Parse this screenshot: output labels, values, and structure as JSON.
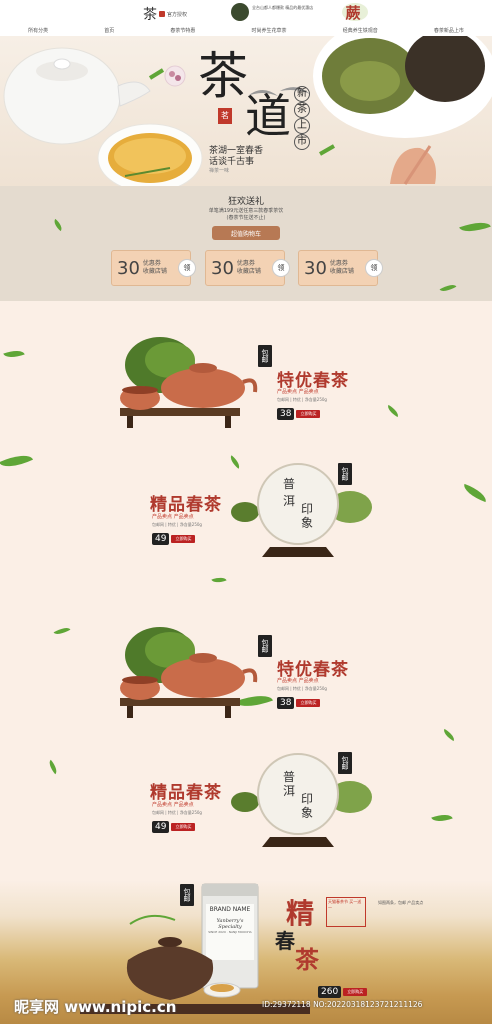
{
  "header": {
    "logo_char": "茶",
    "shop_name": "官方授权",
    "badge1_text": "全台山都人都爆款 精品的最优惠店",
    "badge2_char": "蕨"
  },
  "nav": {
    "items": [
      "所有分类",
      "首页",
      "春茶节特惠",
      "时尚养生花草茶",
      "经典养生铁观音",
      "春茶新品上市"
    ]
  },
  "hero": {
    "title_chars": [
      "茶",
      "道"
    ],
    "vertical_tag": [
      "新",
      "茶",
      "上",
      "市"
    ],
    "subtitle_line1": "茶湖一室春香",
    "subtitle_line2": "话谈千古事",
    "small_note": "禅茶一味",
    "stamp_text": "茗"
  },
  "promo": {
    "title": "狂欢送礼",
    "line1": "单笔满199元送任意三款春季茶饮",
    "line2": "(春茶节狂送不止)",
    "banner": "超值购物车",
    "coupons": [
      {
        "amount": "30",
        "label1": "优惠券",
        "label2": "收藏店铺",
        "action": "领"
      },
      {
        "amount": "30",
        "label1": "优惠券",
        "label2": "收藏店铺",
        "action": "领"
      },
      {
        "amount": "30",
        "label1": "优惠券",
        "label2": "收藏店铺",
        "action": "领"
      }
    ]
  },
  "products": [
    {
      "title": "特优春茶",
      "desc": "产品卖点 产品卖点",
      "meta": "包邮网 | 特优 | 净含量250g",
      "price": "38",
      "buy": "立即购买",
      "seal": "包邮"
    },
    {
      "title": "精品春茶",
      "desc": "产品卖点 产品卖点",
      "meta": "包邮网 | 特优 | 净含量250g",
      "price": "49",
      "buy": "立即购买",
      "seal": "包邮",
      "badge_chars": [
        "普",
        "洱",
        "印",
        "象"
      ]
    },
    {
      "title": "特优春茶",
      "desc": "产品卖点 产品卖点",
      "meta": "包邮网 | 特优 | 净含量250g",
      "price": "38",
      "buy": "立即购买",
      "seal": "包邮"
    },
    {
      "title": "精品春茶",
      "desc": "产品卖点 产品卖点",
      "meta": "包邮网 | 特优 | 净含量250g",
      "price": "49",
      "buy": "立即购买",
      "seal": "包邮",
      "badge_chars": [
        "普",
        "洱",
        "印",
        "象"
      ]
    }
  ],
  "final_product": {
    "seal": "包邮",
    "can_brand": "BRAND NAME",
    "can_script": "Yanberry's Specialty",
    "can_sub": "SINCE 2020 · NANJI MOOCHA",
    "title1": "精",
    "title2": "春",
    "title3": "茶",
    "tag_text": "天猫春茶节 买一送一",
    "desc": "如图两条，包邮 产品卖点",
    "price": "260",
    "buy": "立即购买"
  },
  "watermark": {
    "left": "昵享网 www.nipic.cn",
    "right": "ID:29372118 NO:20220318123721211126"
  },
  "colors": {
    "accent_red": "#b03a2e",
    "leaf_green": "#5fa637",
    "background": "#fbefe6"
  }
}
